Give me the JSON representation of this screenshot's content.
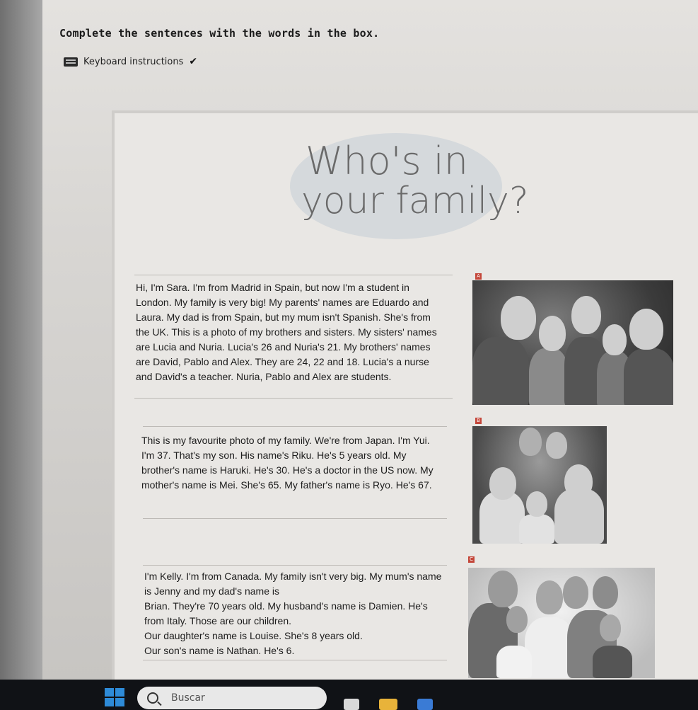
{
  "instruction": "Complete the sentences with the words in the box.",
  "keyboard": {
    "label": "Keyboard instructions",
    "icon": "keyboard-icon",
    "chevron": "chevron-down-icon"
  },
  "heading": {
    "line1": "Who's in",
    "line2": "your family?"
  },
  "texts": {
    "a": "Hi, I'm Sara. I'm from Madrid in Spain, but now I'm a student in London. My family is very big! My parents' names are Eduardo and Laura. My dad is from Spain, but my mum isn't Spanish. She's from the UK. This is a photo of my brothers and sisters. My sisters' names are Lucia and Nuria. Lucia's 26 and Nuria's 21. My brothers' names are David, Pablo and Alex. They are 24, 22 and 18. Lucia's a nurse and David's a teacher. Nuria, Pablo and Alex are students.",
    "b": "This is my favourite photo of my family. We're from Japan. I'm Yui. I'm 37. That's my son. His name's Riku. He's 5 years old. My brother's name is Haruki. He's 30. He's a doctor in the US now. My mother's name is Mei. She's 65. My father's name is Ryo. He's 67.",
    "c1": "I'm Kelly. I'm from Canada. My family isn't very big. My mum's name is Jenny and my dad's name is",
    "c2": "Brian. They're 70 years old. My husband's name is Damien. He's from Italy. Those are our children.",
    "c3": "Our daughter's name is Louise. She's 8 years old.",
    "c4": "Our son's name is Nathan. He's 6."
  },
  "photo_labels": {
    "a": "A",
    "b": "B",
    "c": "C"
  },
  "taskbar": {
    "search_placeholder": "Buscar"
  },
  "colors": {
    "accent_blue": "#2e8bd8",
    "badge_red": "#c4473a"
  }
}
